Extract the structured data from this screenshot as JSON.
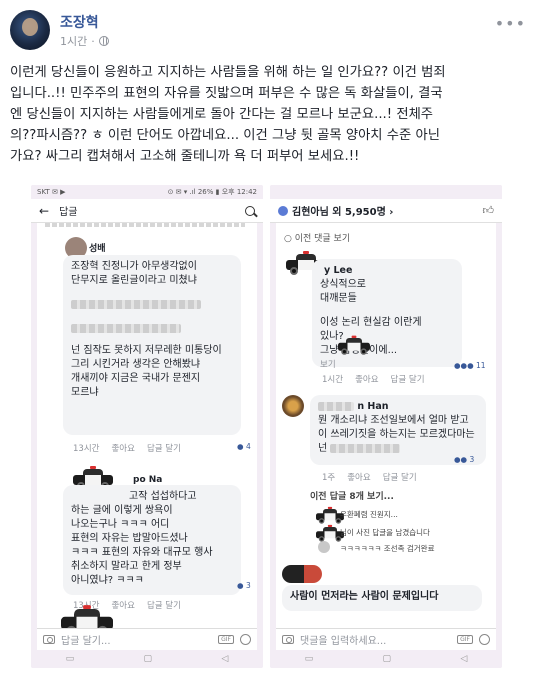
{
  "post": {
    "author": "조장혁",
    "time": "1시간",
    "more": "•••",
    "lines": [
      "이런게 당신들이 응원하고 지지하는 사람들을 위해 하는 일 인가요?? 이건 범죄",
      "입니다..!! 민주주의 표현의 자유를 짓밟으며 퍼부은 수 많은 독 화살들이, 결국",
      "엔 당신들이 지지하는 사람들에게로 돌아 간다는 걸 모르나 보군요...! 전체주",
      "의??파시즘?? ㅎ 이런 단어도 아깝네요... 이건 그냥 뒷 골목 양아치 수준 아닌",
      "가요? 싸그리 캡쳐해서 고소해 줄테니까 욕 더 퍼부어 보세요.!!"
    ]
  },
  "left_phone": {
    "status_left": "SKT ✉ ▶",
    "status_right": "⊙ ✉ ▾ .ıl 26% ▮ 오후 12:42",
    "back": "←",
    "title": "답글",
    "search_icon": "search-icon",
    "c1": {
      "name": "성배",
      "lines": [
        "조장혁 진정니가 아무생각없이",
        "단무지로 올린글이라고 미쳤냐"
      ],
      "lines2": [
        "넌 짐작도 못하지 저무레한 미통당이",
        "그리 시킨거라 생각은 안해봤냐",
        "개새끼야 지금은 국내가 문젠지",
        "모르냐"
      ],
      "time": "13시간",
      "like": "좋아요",
      "reply": "답글 달기",
      "reacts": "4"
    },
    "c2": {
      "name": "po Na",
      "lines": [
        "고작 섭섭하다고",
        "하는 글에 이렇게 쌍욕이",
        "나오는구나 ㅋㅋㅋ 어디",
        "표현의 자유는 밥말아드셨나",
        "ㅋㅋㅋ 표현의 자유와 대규모 행사",
        "취소하지 말라고 한게 정부",
        "아니였냐? ㅋㅋㅋ"
      ],
      "time": "13시간",
      "like": "좋아요",
      "reply": "답글 달기",
      "reacts": "3"
    },
    "input": "답글 달기...",
    "nav": [
      "▭",
      "▢",
      "◁"
    ]
  },
  "right_phone": {
    "header": "김현아님 외 5,950명 ›",
    "prev": "이전 댓글 보기",
    "c1": {
      "name": "y Lee",
      "lines": [
        "상식적으로",
        "대깨문들",
        "",
        "이성 논리 현실감 이란게",
        "있나?",
        "그냥        감정팔이에..."
      ],
      "time": "보기",
      "reacts": "11"
    },
    "c1_meta": {
      "time": "1시간",
      "like": "좋아요",
      "reply": "답글 달기"
    },
    "c2": {
      "name": "n Han",
      "lines": [
        "뭔 개소리냐 조선일보에서 얼마 받고",
        "이 쓰레기짓을 하는지는 모르겠다마는",
        "넌"
      ],
      "time": "1주",
      "like": "좋아요",
      "reply": "답글 달기",
      "reacts": "3"
    },
    "prev_replies": "이전 답글 8개 보기...",
    "r1": "우환폐렴 진원지...",
    "r2": "님이 사진 답글을 남겼습니다",
    "r3": "ㅋㅋㅋㅋㅋㅋ 조선족 검거완료",
    "c3": "사람이 먼저라는 사람이 문제입니다",
    "input": "댓글을 입력하세요...",
    "nav": [
      "▭",
      "▢",
      "◁"
    ]
  }
}
